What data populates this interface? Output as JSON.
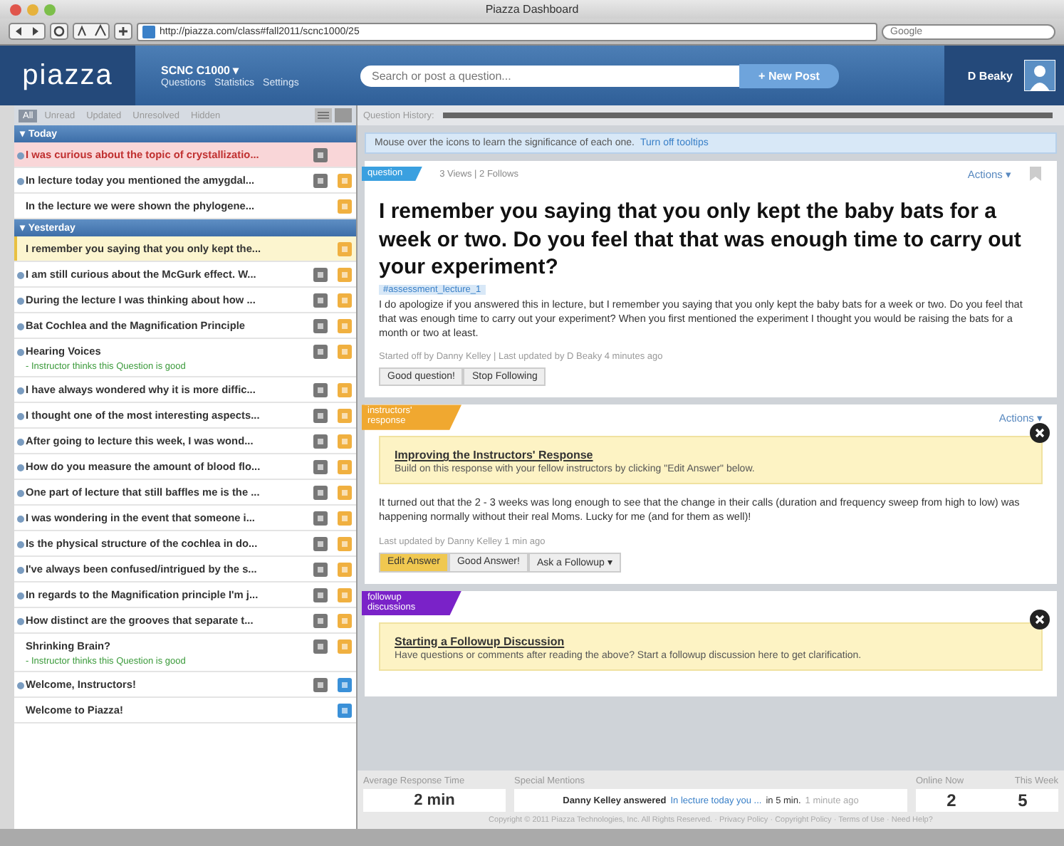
{
  "window": {
    "title": "Piazza Dashboard"
  },
  "browser": {
    "url": "http://piazza.com/class#fall2011/scnc1000/25",
    "search_placeholder": "Google"
  },
  "header": {
    "logo": "piazza",
    "course": "SCNC C1000 ▾",
    "nav": [
      "Questions",
      "Statistics",
      "Settings"
    ],
    "search_placeholder": "Search or post a question...",
    "new_post": "+ New Post",
    "user": "D Beaky"
  },
  "filters": [
    {
      "label": "All",
      "selected": true
    },
    {
      "label": "Unread",
      "selected": false
    },
    {
      "label": "Updated",
      "selected": false
    },
    {
      "label": "Unresolved",
      "selected": false
    },
    {
      "label": "Hidden",
      "selected": false
    }
  ],
  "groups": [
    {
      "title": "▾ Today",
      "items": [
        {
          "title": "I was curious about the topic of crystallizatio...",
          "unread": true,
          "flagged": true,
          "selected": false,
          "instructor": true
        },
        {
          "title": "In lecture today you mentioned the amygdal...",
          "unread": true,
          "flagged": false,
          "selected": false,
          "instructor": true,
          "color": "#f0b040"
        },
        {
          "title": "In the lecture we were shown the phylogene...",
          "unread": false,
          "flagged": false,
          "selected": false,
          "instructor": false,
          "color": "#f0b040"
        }
      ]
    },
    {
      "title": "▾ Yesterday",
      "items": [
        {
          "title": "I remember you saying that you only kept the...",
          "unread": false,
          "flagged": false,
          "selected": true,
          "instructor": false,
          "color": "#f0b040"
        },
        {
          "title": "I am still curious about the McGurk effect. W...",
          "unread": true,
          "flagged": false,
          "selected": false,
          "instructor": true,
          "color": "#f0b040"
        },
        {
          "title": "During the lecture I was thinking about how ...",
          "unread": true,
          "flagged": false,
          "selected": false,
          "instructor": true,
          "color": "#f0b040"
        },
        {
          "title": "Bat Cochlea and the Magnification Principle",
          "unread": true,
          "flagged": false,
          "selected": false,
          "instructor": true,
          "color": "#f0b040"
        },
        {
          "title": "Hearing Voices",
          "note": "- Instructor thinks this Question is good",
          "unread": true,
          "flagged": false,
          "selected": false,
          "instructor": true,
          "color": "#f0b040"
        },
        {
          "title": "I have always wondered why it is more diffic...",
          "unread": true,
          "flagged": false,
          "selected": false,
          "instructor": true,
          "color": "#f0b040"
        },
        {
          "title": "I thought one of the most interesting aspects...",
          "unread": true,
          "flagged": false,
          "selected": false,
          "instructor": true,
          "color": "#f0b040"
        },
        {
          "title": "After going to lecture this week, I was wond...",
          "unread": true,
          "flagged": false,
          "selected": false,
          "instructor": true,
          "color": "#f0b040"
        },
        {
          "title": "How do you measure the amount of blood flo...",
          "unread": true,
          "flagged": false,
          "selected": false,
          "instructor": true,
          "color": "#f0b040"
        },
        {
          "title": "One part of lecture that still baffles me is the ...",
          "unread": true,
          "flagged": false,
          "selected": false,
          "instructor": true,
          "color": "#f0b040"
        },
        {
          "title": "I was wondering in the event that someone i...",
          "unread": true,
          "flagged": false,
          "selected": false,
          "instructor": true,
          "color": "#f0b040"
        },
        {
          "title": "Is the physical structure of the cochlea in do...",
          "unread": true,
          "flagged": false,
          "selected": false,
          "instructor": true,
          "color": "#f0b040"
        },
        {
          "title": "I've always been confused/intrigued by the s...",
          "unread": true,
          "flagged": false,
          "selected": false,
          "instructor": true,
          "color": "#f0b040"
        },
        {
          "title": "In regards to the Magnification principle I'm j...",
          "unread": true,
          "flagged": false,
          "selected": false,
          "instructor": true,
          "color": "#f0b040"
        },
        {
          "title": "How distinct are the grooves that separate t...",
          "unread": true,
          "flagged": false,
          "selected": false,
          "instructor": true,
          "color": "#f0b040"
        },
        {
          "title": "Shrinking Brain?",
          "note": "- Instructor thinks this Question is good",
          "unread": false,
          "flagged": false,
          "selected": false,
          "instructor": true,
          "color": "#f0b040"
        },
        {
          "title": "Welcome, Instructors!",
          "unread": true,
          "flagged": false,
          "selected": false,
          "instructor": true,
          "color": "#3a90d8"
        },
        {
          "title": "Welcome to Piazza!",
          "unread": false,
          "flagged": false,
          "selected": false,
          "instructor": false,
          "color": "#3a90d8"
        }
      ]
    }
  ],
  "history": {
    "label": "Question History:",
    "level": 1
  },
  "tip": {
    "text": "Mouse over the icons to learn the significance of each one.",
    "link": "Turn off tooltips"
  },
  "question": {
    "tag": "question",
    "stats": "3 Views | 2 Follows",
    "actions": "Actions ▾",
    "title": "I remember you saying that you only kept the baby bats for a week or two. Do you feel that that was enough time to carry out your experiment?",
    "folder": "#assessment_lecture_1",
    "body": "I do apologize if you answered this in lecture, but I remember you saying that you only kept the baby bats for a week or two. Do you feel that that was enough time to carry out your experiment? When you first mentioned the experiment I thought you would be raising the bats for a month or two at least.",
    "meta": "Started off by Danny Kelley | Last updated by D Beaky 4 minutes ago",
    "buttons": [
      "Good question!",
      "Stop Following"
    ]
  },
  "answer": {
    "tag": "instructors' response",
    "actions": "Actions ▾",
    "notice_title": "Improving the Instructors' Response",
    "notice_text": "Build on this response with your fellow instructors by clicking \"Edit Answer\" below.",
    "body": "It turned out that the 2 - 3 weeks was long enough to see that the change in their calls (duration and frequency sweep from high to low) was happening normally without their real Moms. Lucky for me (and for them as well)!",
    "meta": "Last updated by Danny Kelley 1 min ago",
    "buttons": [
      "Edit Answer",
      "Good Answer!",
      "Ask a Followup ▾"
    ]
  },
  "followup": {
    "tag": "followup discussions",
    "notice_title": "Starting a Followup Discussion",
    "notice_text": "Have questions or comments after reading the above? Start a followup discussion here to get clarification."
  },
  "stats": {
    "response_label": "Average Response Time",
    "response": "2 min",
    "mentions_label": "Special Mentions",
    "mention_name": "Danny Kelley answered",
    "mention_link": "In lecture today you ...",
    "mention_rest": "in 5 min.",
    "mention_time": "1 minute ago",
    "online_label": "Online Now",
    "week_label": "This Week",
    "online": "2",
    "week": "5"
  },
  "copyright": "Copyright © 2011 Piazza Technologies, Inc. All Rights Reserved. · Privacy Policy · Copyright Policy · Terms of Use · Need Help?"
}
